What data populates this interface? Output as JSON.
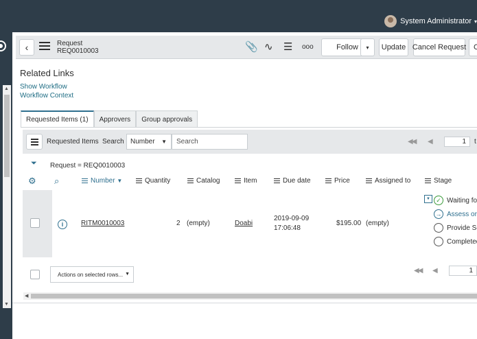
{
  "topbar": {
    "user_name": "System Administrator",
    "caret": "▾"
  },
  "header": {
    "record_type": "Request",
    "record_number": "REQ0010003",
    "buttons": {
      "follow": "Follow",
      "follow_caret": "▾",
      "update": "Update",
      "cancel": "Cancel Request",
      "more": "C"
    },
    "icons": {
      "back": "‹",
      "attach": "📎",
      "activity": "∿",
      "settings": "☰",
      "more": "ooo"
    }
  },
  "related_links": {
    "title": "Related Links",
    "links": [
      "Show Workflow",
      "Workflow Context"
    ]
  },
  "tabs": [
    {
      "label": "Requested Items (1)",
      "active": true
    },
    {
      "label": "Approvers",
      "active": false
    },
    {
      "label": "Group approvals",
      "active": false
    }
  ],
  "list": {
    "title": "Requested Items",
    "search_label": "Search",
    "search_field": "Number",
    "search_placeholder": "Search",
    "page_value": "1",
    "page_suffix": "t",
    "filter_text": "Request = REQ0010003",
    "columns": [
      "Number",
      "Quantity",
      "Catalog",
      "Item",
      "Due date",
      "Price",
      "Assigned to",
      "Stage"
    ],
    "sort_indicator": "▼",
    "rows": [
      {
        "number": "RITM0010003",
        "quantity": "2",
        "catalog": "(empty)",
        "item": "Doabi",
        "due_date_line1": "2019-09-09",
        "due_date_line2": "17:06:48",
        "price": "$195.00",
        "assigned_to": "(empty)",
        "stages": [
          {
            "label": "Waiting for",
            "state": "done"
          },
          {
            "label": "Assess or S",
            "state": "current"
          },
          {
            "label": "Provide Se",
            "state": "pending"
          },
          {
            "label": "Completed",
            "state": "pending"
          }
        ]
      }
    ],
    "actions_label": "Actions on selected rows...",
    "bottom_page_value": "1"
  },
  "colors": {
    "topbar": "#2e3d49",
    "link": "#1f6d84",
    "accent": "#2e6f8e",
    "done": "#3a9a3a"
  }
}
